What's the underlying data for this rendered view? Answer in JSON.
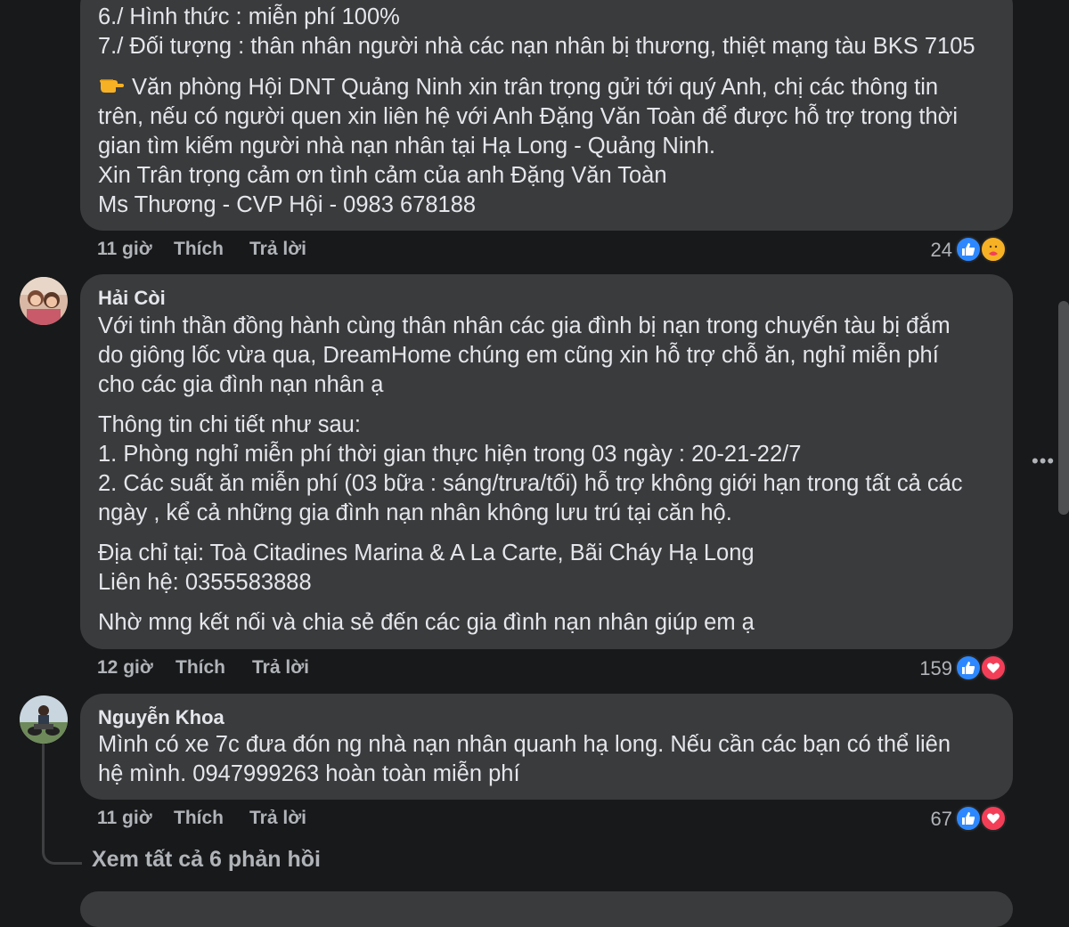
{
  "comment1": {
    "lines": [
      "6./ Hình thức : miễn phí 100%",
      "7./ Đối tượng : thân nhân người nhà các nạn nhân bị thương, thiệt mạng tàu BKS 7105",
      "Văn phòng Hội DNT Quảng Ninh xin trân trọng gửi tới quý Anh, chị các thông tin",
      "trên, nếu có người quen xin liên hệ với Anh Đặng Văn Toàn để được hỗ trợ trong thời",
      "gian tìm kiếm người nhà nạn nhân tại Hạ Long - Quảng Ninh.",
      "Xin Trân trọng cảm ơn tình cảm của anh Đặng Văn Toàn",
      "Ms Thương - CVP Hội - 0983 678188"
    ],
    "time": "11 giờ",
    "like_label": "Thích",
    "reply_label": "Trả lời",
    "reaction_count": "24",
    "reactions": [
      "like-icon",
      "care-icon"
    ]
  },
  "comment2": {
    "author": "Hải Còi",
    "lines": [
      "Với tinh thần đồng hành cùng thân nhân các gia đình bị nạn trong chuyến tàu bị đắm",
      "do giông lốc vừa qua, DreamHome chúng em cũng xin hỗ trợ chỗ ăn, nghỉ miễn phí",
      "cho các gia đình nạn nhân ạ",
      "Thông tin chi tiết như sau:",
      "1. Phòng nghỉ miễn phí thời gian thực hiện trong 03 ngày : 20-21-22/7",
      "2. Các suất ăn miễn phí (03 bữa : sáng/trưa/tối) hỗ trợ không giới hạn trong tất cả các",
      "ngày , kể cả những gia đình nạn nhân không lưu trú tại căn hộ.",
      "Địa chỉ tại: Toà Citadines Marina & A La Carte, Bãi Cháy Hạ Long",
      "Liên hệ: 0355583888",
      "Nhờ mng kết nối và chia sẻ đến các gia đình nạn nhân giúp em ạ"
    ],
    "time": "12 giờ",
    "like_label": "Thích",
    "reply_label": "Trả lời",
    "reaction_count": "159",
    "reactions": [
      "like-icon",
      "love-icon"
    ]
  },
  "comment3": {
    "author": "Nguyễn Khoa",
    "lines": [
      "Mình có xe 7c đưa đón ng nhà nạn nhân quanh hạ long. Nếu cần các bạn có thể liên",
      "hệ mình. 0947999263 hoàn toàn miễn phí"
    ],
    "time": "11 giờ",
    "like_label": "Thích",
    "reply_label": "Trả lời",
    "reaction_count": "67",
    "reactions": [
      "like-icon",
      "love-icon"
    ]
  },
  "view_replies": "Xem tất cả 6 phản hồi",
  "more_options": "•••",
  "colors": {
    "background": "#18191a",
    "bubble": "#3a3b3c",
    "text": "#e4e6eb",
    "secondary": "#b0b3b8",
    "like_blue": "#2d88ff",
    "love_red": "#f33e58",
    "care_yellow": "#f7b125"
  }
}
